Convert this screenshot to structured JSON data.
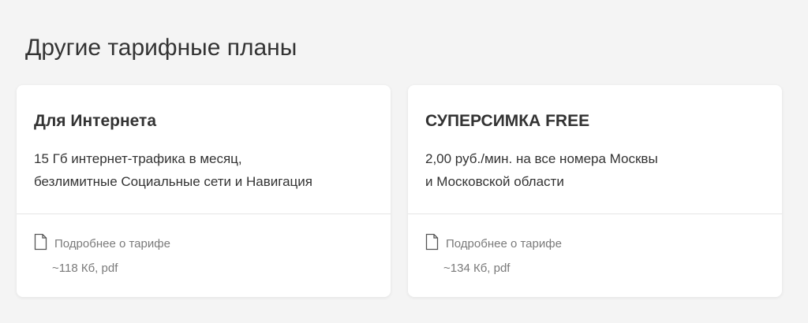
{
  "section": {
    "title": "Другие тарифные планы"
  },
  "cards": [
    {
      "title": "Для Интернета",
      "description_line1": "15 Гб интернет-трафика в месяц,",
      "description_line2": "безлимитные Социальные сети и Навигация",
      "doc_label": "Подробнее о тарифе",
      "doc_meta": "~118 Кб, pdf",
      "doc_icon": "document-icon"
    },
    {
      "title": "СУПЕРСИМКА FREE",
      "description_line1": "2,00 руб./мин. на все номера Москвы",
      "description_line2": "и Московской области",
      "doc_label": "Подробнее о тарифе",
      "doc_meta": "~134 Кб, pdf",
      "doc_icon": "document-icon"
    }
  ],
  "colors": {
    "background": "#f4f4f4",
    "card": "#ffffff",
    "text": "#333333",
    "muted": "#7a7a7a",
    "divider": "#e6e6e6"
  }
}
